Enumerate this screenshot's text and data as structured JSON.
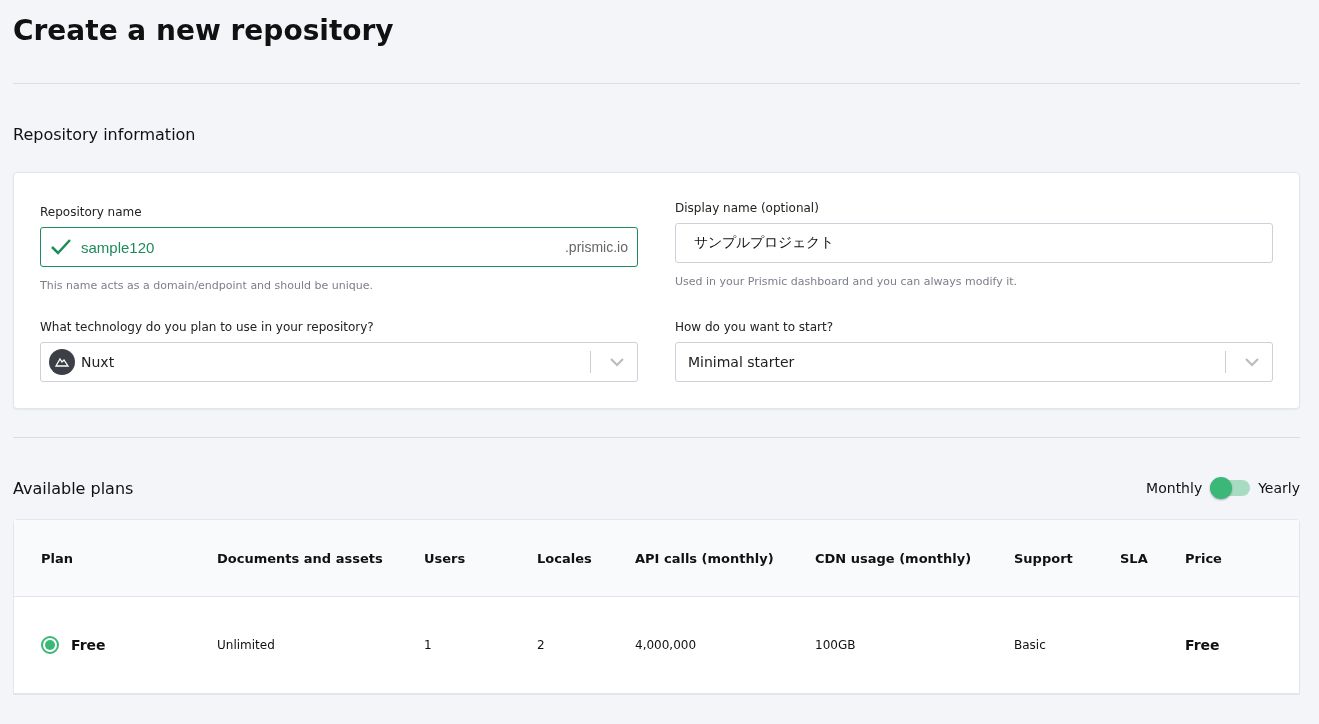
{
  "title": "Create a new repository",
  "info_section": {
    "heading": "Repository information",
    "repository_name": {
      "label": "Repository name",
      "value": "sample120",
      "valid": true,
      "suffix": ".prismic.io",
      "help": "This name acts as a domain/endpoint and should be unique."
    },
    "display_name": {
      "label": "Display name (optional)",
      "value": "サンプルプロジェクト",
      "help": "Used in your Prismic dashboard and you can always modify it."
    },
    "technology": {
      "label": "What technology do you plan to use in your repository?",
      "value": "Nuxt"
    },
    "start": {
      "label": "How do you want to start?",
      "value": "Minimal starter"
    }
  },
  "plans_section": {
    "heading": "Available plans",
    "billing": {
      "left_label": "Monthly",
      "right_label": "Yearly",
      "yearly": false
    },
    "table": {
      "columns": [
        "Plan",
        "Documents and assets",
        "Users",
        "Locales",
        "API calls (monthly)",
        "CDN usage (monthly)",
        "Support",
        "SLA",
        "Price"
      ],
      "rows": [
        {
          "selected": true,
          "cells": [
            "Free",
            "Unlimited",
            "1",
            "2",
            "4,000,000",
            "100GB",
            "Basic",
            "",
            "Free"
          ]
        }
      ]
    }
  }
}
